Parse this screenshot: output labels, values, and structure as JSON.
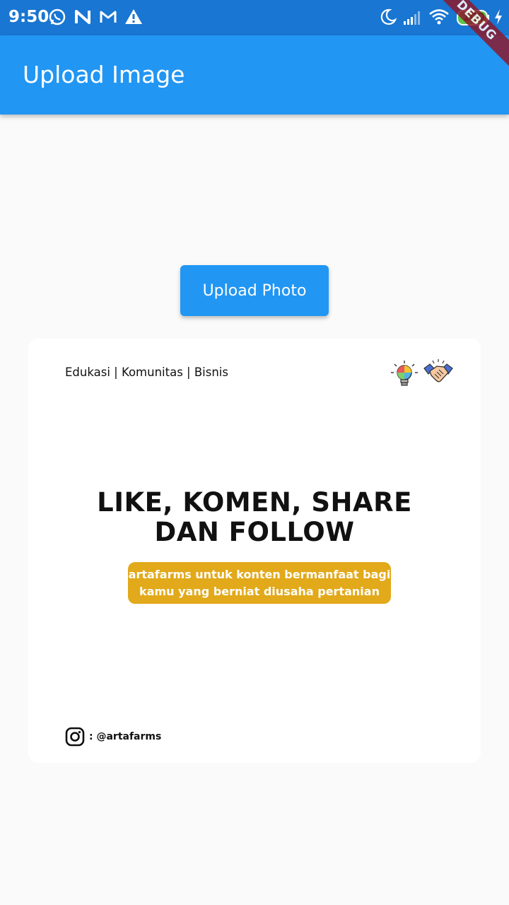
{
  "status_bar": {
    "time": "9:50",
    "battery": "100",
    "icons": [
      "whatsapp-icon",
      "n-app-icon",
      "gmail-icon",
      "warning-icon",
      "moon-icon",
      "signal-icon",
      "wifi-icon",
      "battery-icon",
      "charging-icon"
    ]
  },
  "debug_banner": "DEBUG",
  "app_bar": {
    "title": "Upload Image"
  },
  "upload_button": {
    "label": "Upload Photo"
  },
  "card": {
    "tagline": "Edukasi | Komunitas | Bisnis",
    "headline_line1": "LIKE, KOMEN, SHARE",
    "headline_line2": "DAN FOLLOW",
    "pill_line1": "artafarms untuk konten bermanfaat bagi",
    "pill_line2": "kamu yang berniat diusaha pertanian",
    "instagram_handle": ": @artafarms",
    "icons": [
      "lightbulb-icon",
      "handshake-icon",
      "instagram-icon"
    ]
  },
  "colors": {
    "status_bar": "#1976d2",
    "app_bar": "#2196f3",
    "button": "#2196f3",
    "pill": "#e2a91a",
    "background": "#fafafa"
  }
}
